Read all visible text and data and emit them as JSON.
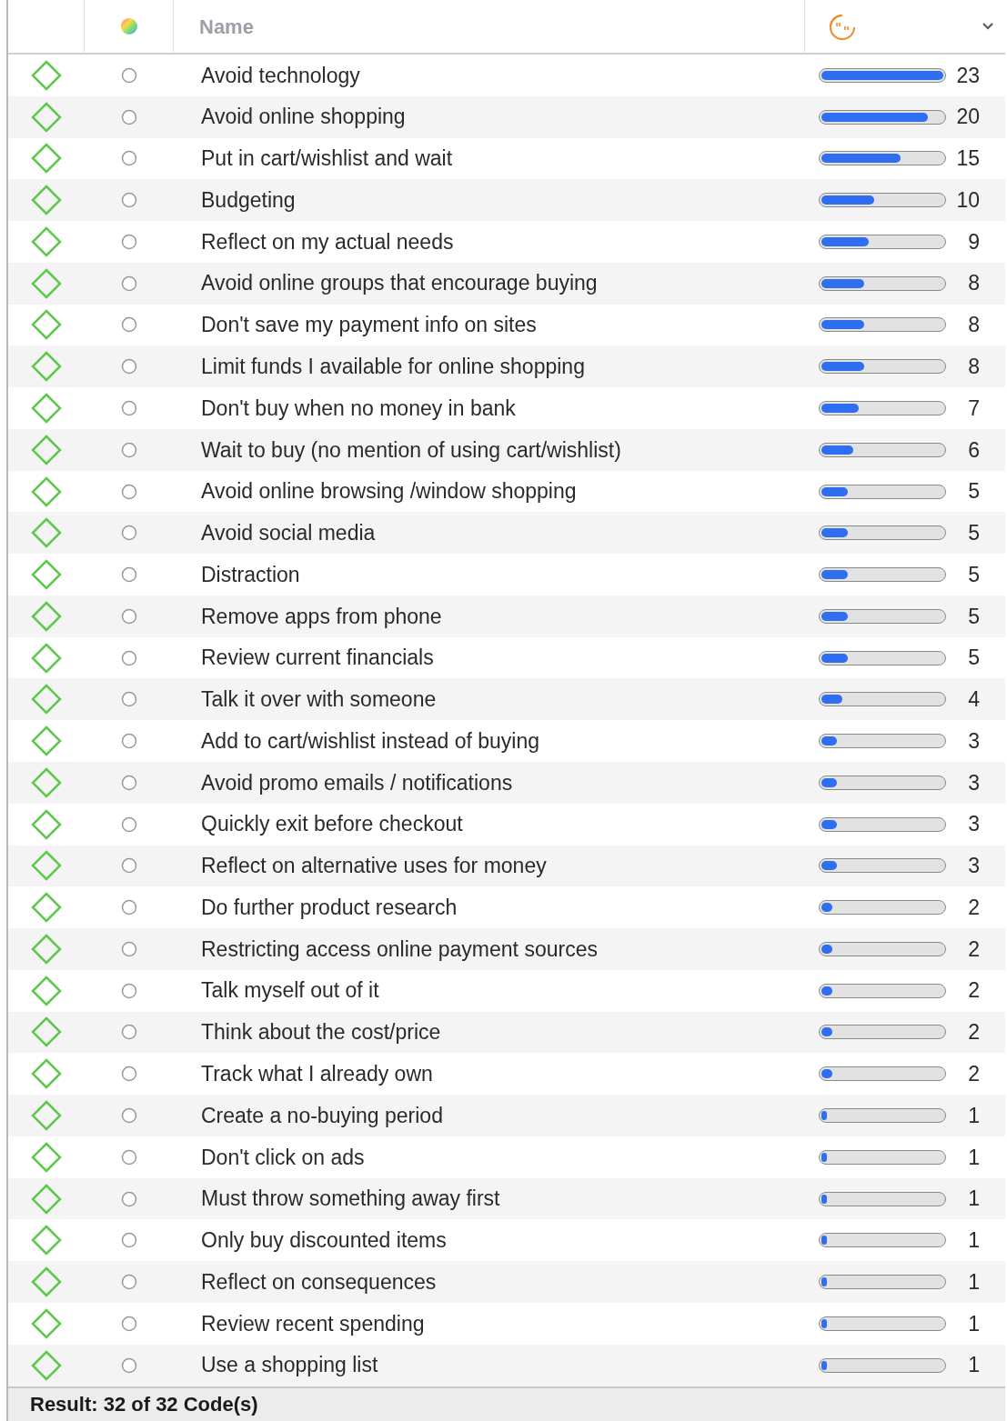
{
  "columns": [
    {
      "label": "Name"
    }
  ],
  "rows": [
    {
      "name": "Avoid technology",
      "count": "23",
      "level": 1
    },
    {
      "name": "Avoid online shopping",
      "count": "20",
      "level": 0.87
    },
    {
      "name": "Put in cart/wishlist and wait",
      "count": "15",
      "level": 0.652
    },
    {
      "name": "Budgeting",
      "count": "10",
      "level": 0.435
    },
    {
      "name": "Reflect on my actual needs",
      "count": "9",
      "level": 0.391
    },
    {
      "name": "Avoid online groups that encourage buying",
      "count": "8",
      "level": 0.348
    },
    {
      "name": "Don't save my payment info on sites",
      "count": "8",
      "level": 0.348
    },
    {
      "name": "Limit funds I available for online shopping",
      "count": "8",
      "level": 0.348
    },
    {
      "name": "Don't buy when no money in bank",
      "count": "7",
      "level": 0.304
    },
    {
      "name": "Wait to buy (no mention of using cart/wishlist)",
      "count": "6",
      "level": 0.261
    },
    {
      "name": "Avoid online browsing /window shopping",
      "count": "5",
      "level": 0.217
    },
    {
      "name": "Avoid social media",
      "count": "5",
      "level": 0.217
    },
    {
      "name": "Distraction",
      "count": "5",
      "level": 0.217
    },
    {
      "name": "Remove apps from phone",
      "count": "5",
      "level": 0.217
    },
    {
      "name": "Review current financials",
      "count": "5",
      "level": 0.217
    },
    {
      "name": "Talk it over with someone",
      "count": "4",
      "level": 0.174
    },
    {
      "name": "Add to cart/wishlist instead of buying",
      "count": "3",
      "level": 0.13
    },
    {
      "name": "Avoid promo emails / notifications",
      "count": "3",
      "level": 0.13
    },
    {
      "name": "Quickly exit before checkout",
      "count": "3",
      "level": 0.13
    },
    {
      "name": "Reflect on alternative uses for money",
      "count": "3",
      "level": 0.13
    },
    {
      "name": "Do further product research",
      "count": "2",
      "level": 0.087
    },
    {
      "name": "Restricting access online payment sources",
      "count": "2",
      "level": 0.087
    },
    {
      "name": "Talk myself out of it",
      "count": "2",
      "level": 0.087
    },
    {
      "name": "Think about the cost/price",
      "count": "2",
      "level": 0.087
    },
    {
      "name": "Track what I already own",
      "count": "2",
      "level": 0.087
    },
    {
      "name": "Create a no-buying period",
      "count": "1",
      "level": 0.043
    },
    {
      "name": "Don't click on ads",
      "count": "1",
      "level": 0.043
    },
    {
      "name": "Must throw something away first",
      "count": "1",
      "level": 0.043
    },
    {
      "name": "Only buy discounted items",
      "count": "1",
      "level": 0.043
    },
    {
      "name": "Reflect on consequences",
      "count": "1",
      "level": 0.043
    },
    {
      "name": "Review recent spending",
      "count": "1",
      "level": 0.043
    },
    {
      "name": "Use a shopping list",
      "count": "1",
      "level": 0.043
    }
  ],
  "status_bar": "Result: 32 of 32 Code(s)"
}
